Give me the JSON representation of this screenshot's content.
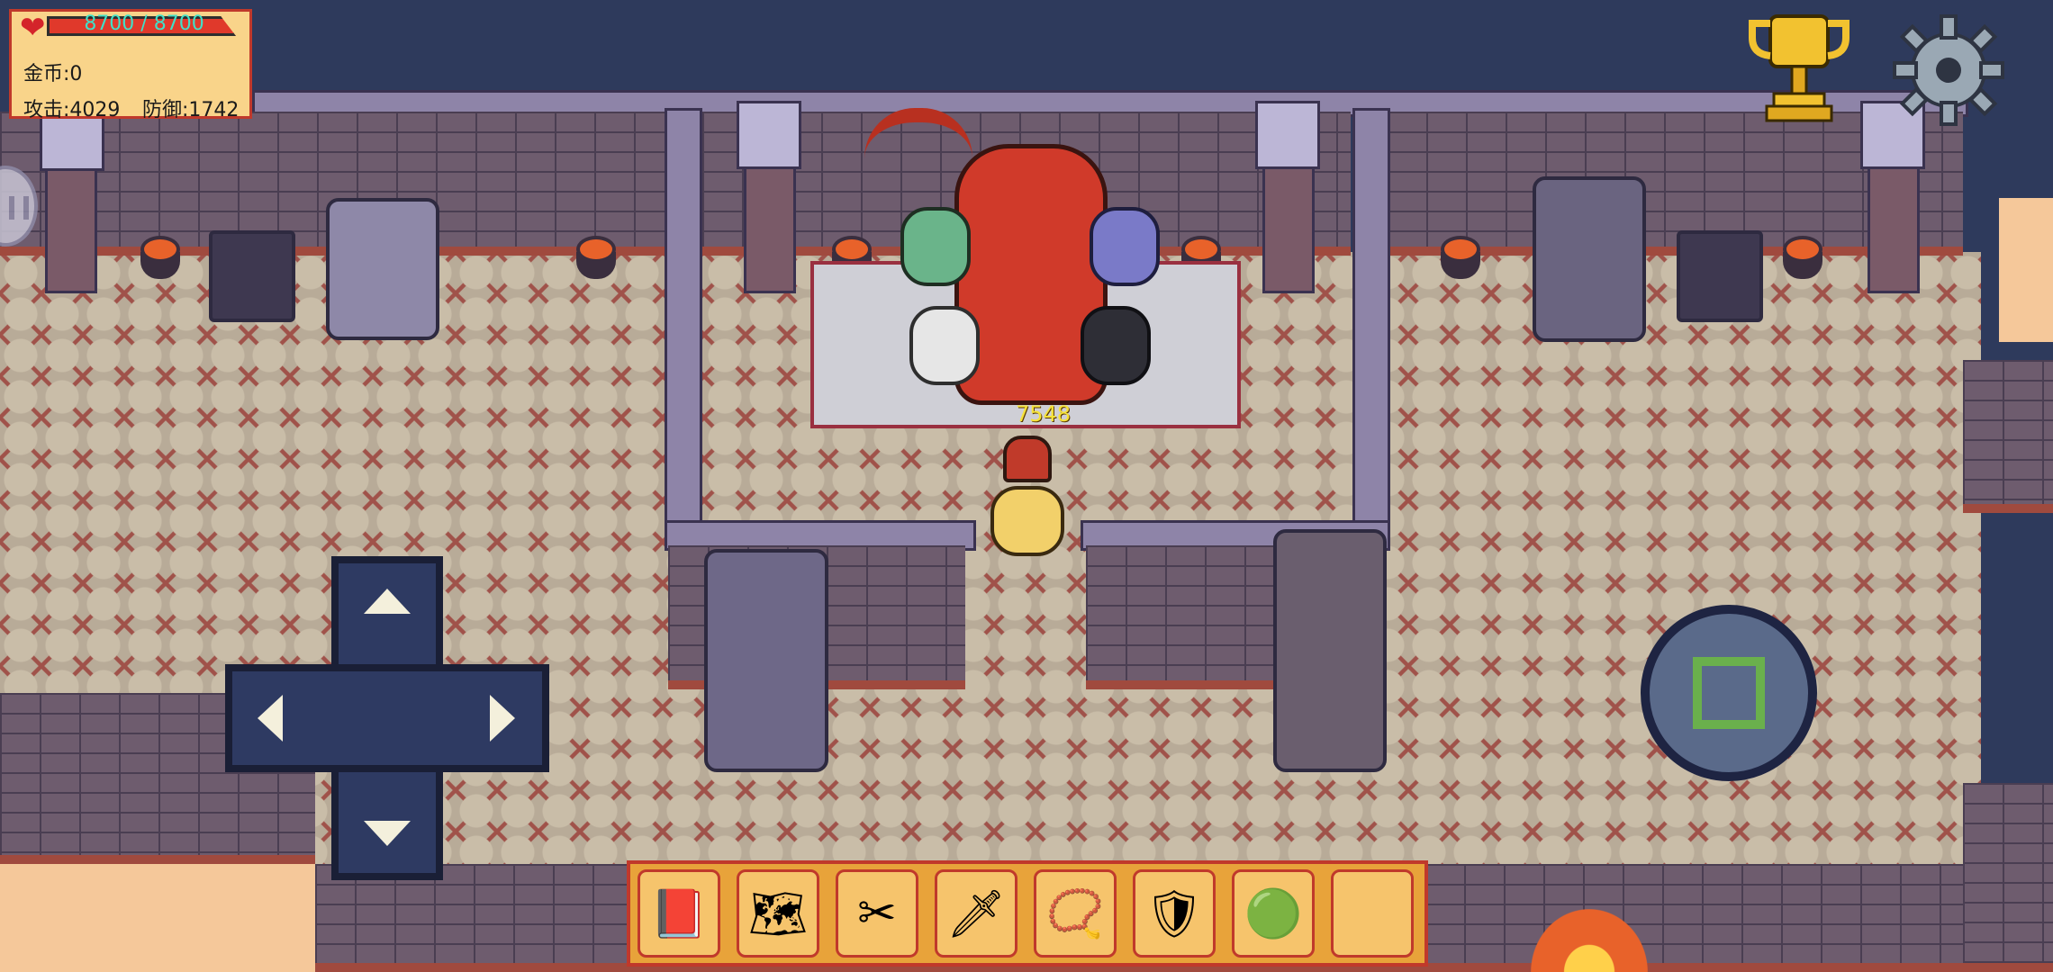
{
  "hud": {
    "hp": "8700 / 8700",
    "hp_fraction": 1.0,
    "gold": "金币:0",
    "attack": "攻击:4029",
    "defense": "防御:1742"
  },
  "combat": {
    "damage_number": "7548"
  },
  "icons": {
    "heart": "heart-icon",
    "trophy": "trophy-icon",
    "settings": "gear-icon",
    "pause": "pause-icon"
  },
  "toolbar": {
    "slots": [
      {
        "name": "monster-book-icon",
        "glyph": "📕"
      },
      {
        "name": "map-icon",
        "glyph": "🗺"
      },
      {
        "name": "scissors-icon",
        "glyph": "✂"
      },
      {
        "name": "sword-icon",
        "glyph": "🗡"
      },
      {
        "name": "necklace-icon",
        "glyph": "📿"
      },
      {
        "name": "shield-icon",
        "glyph": "🛡"
      },
      {
        "name": "green-orb-icon",
        "glyph": "🟢"
      },
      {
        "name": "empty-slot",
        "glyph": ""
      }
    ]
  },
  "colors": {
    "hud_bg": "#f9d48a",
    "hud_border": "#c0392b",
    "hp_text": "#40e0c8",
    "damage_text": "#f5e23a",
    "action_ring": "#6ab04c"
  }
}
